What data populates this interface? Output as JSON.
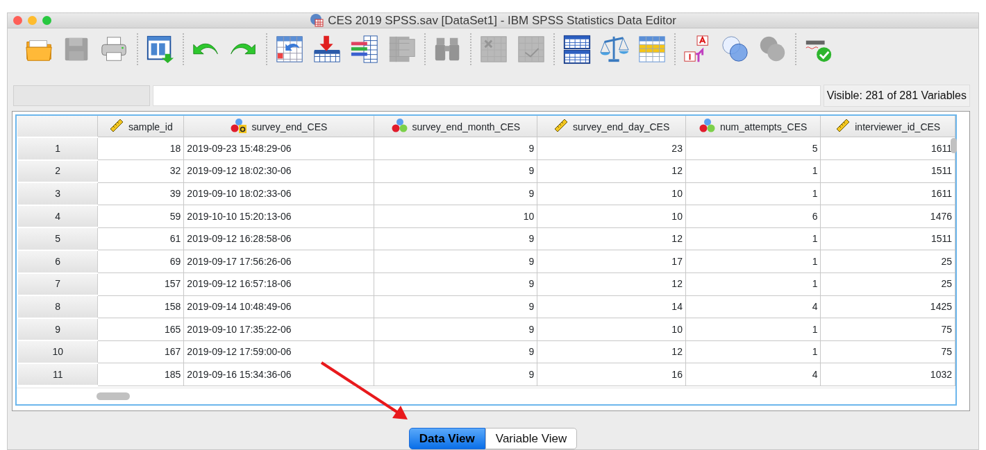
{
  "window": {
    "title": "CES 2019 SPSS.sav [DataSet1] - IBM SPSS Statistics Data Editor"
  },
  "toolbar": {
    "groups": [
      [
        {
          "kind": "open",
          "disabled": false
        },
        {
          "kind": "save",
          "disabled": true
        },
        {
          "kind": "print",
          "disabled": false
        }
      ],
      [
        {
          "kind": "goto-data",
          "disabled": false
        }
      ],
      [
        {
          "kind": "undo",
          "disabled": false
        },
        {
          "kind": "redo",
          "disabled": false
        }
      ],
      [
        {
          "kind": "goto-case",
          "disabled": false
        },
        {
          "kind": "insert-case",
          "disabled": false
        },
        {
          "kind": "insert-variable",
          "disabled": false
        },
        {
          "kind": "variables",
          "disabled": true
        }
      ],
      [
        {
          "kind": "find",
          "disabled": true
        }
      ],
      [
        {
          "kind": "select-cases",
          "disabled": true
        },
        {
          "kind": "chart",
          "disabled": true
        }
      ],
      [
        {
          "kind": "split-file",
          "disabled": false
        },
        {
          "kind": "weight",
          "disabled": false
        },
        {
          "kind": "table",
          "disabled": false
        }
      ],
      [
        {
          "kind": "value-labels",
          "disabled": false
        },
        {
          "kind": "use-sets",
          "disabled": false
        },
        {
          "kind": "show-sets",
          "disabled": true
        }
      ],
      [
        {
          "kind": "spell-check",
          "disabled": false
        }
      ]
    ]
  },
  "visible_count": "Visible: 281 of 281 Variables",
  "table": {
    "columns": [
      {
        "label": "sample_id",
        "kind": "scale"
      },
      {
        "label": "survey_end_CES",
        "kind": "string"
      },
      {
        "label": "survey_end_month_CES",
        "kind": "nominal"
      },
      {
        "label": "survey_end_day_CES",
        "kind": "scale"
      },
      {
        "label": "num_attempts_CES",
        "kind": "nominal"
      },
      {
        "label": "interviewer_id_CES",
        "kind": "scale"
      }
    ],
    "rows": [
      {
        "case": "1",
        "cells": [
          "18",
          "2019-09-23 15:48:29-06",
          "9",
          "23",
          "5",
          "1611"
        ]
      },
      {
        "case": "2",
        "cells": [
          "32",
          "2019-09-12 18:02:30-06",
          "9",
          "12",
          "1",
          "1511"
        ]
      },
      {
        "case": "3",
        "cells": [
          "39",
          "2019-09-10 18:02:33-06",
          "9",
          "10",
          "1",
          "1611"
        ]
      },
      {
        "case": "4",
        "cells": [
          "59",
          "2019-10-10 15:20:13-06",
          "10",
          "10",
          "6",
          "1476"
        ]
      },
      {
        "case": "5",
        "cells": [
          "61",
          "2019-09-12 16:28:58-06",
          "9",
          "12",
          "1",
          "1511"
        ]
      },
      {
        "case": "6",
        "cells": [
          "69",
          "2019-09-17 17:56:26-06",
          "9",
          "17",
          "1",
          "25"
        ]
      },
      {
        "case": "7",
        "cells": [
          "157",
          "2019-09-12 16:57:18-06",
          "9",
          "12",
          "1",
          "25"
        ]
      },
      {
        "case": "8",
        "cells": [
          "158",
          "2019-09-14 10:48:49-06",
          "9",
          "14",
          "4",
          "1425"
        ]
      },
      {
        "case": "9",
        "cells": [
          "165",
          "2019-09-10 17:35:22-06",
          "9",
          "10",
          "1",
          "75"
        ]
      },
      {
        "case": "10",
        "cells": [
          "167",
          "2019-09-12 17:59:00-06",
          "9",
          "12",
          "1",
          "75"
        ]
      },
      {
        "case": "11",
        "cells": [
          "185",
          "2019-09-16 15:34:36-06",
          "9",
          "16",
          "4",
          "1032"
        ]
      }
    ]
  },
  "view_tabs": [
    {
      "label": "Data View",
      "selected": true
    },
    {
      "label": "Variable View",
      "selected": false
    }
  ]
}
